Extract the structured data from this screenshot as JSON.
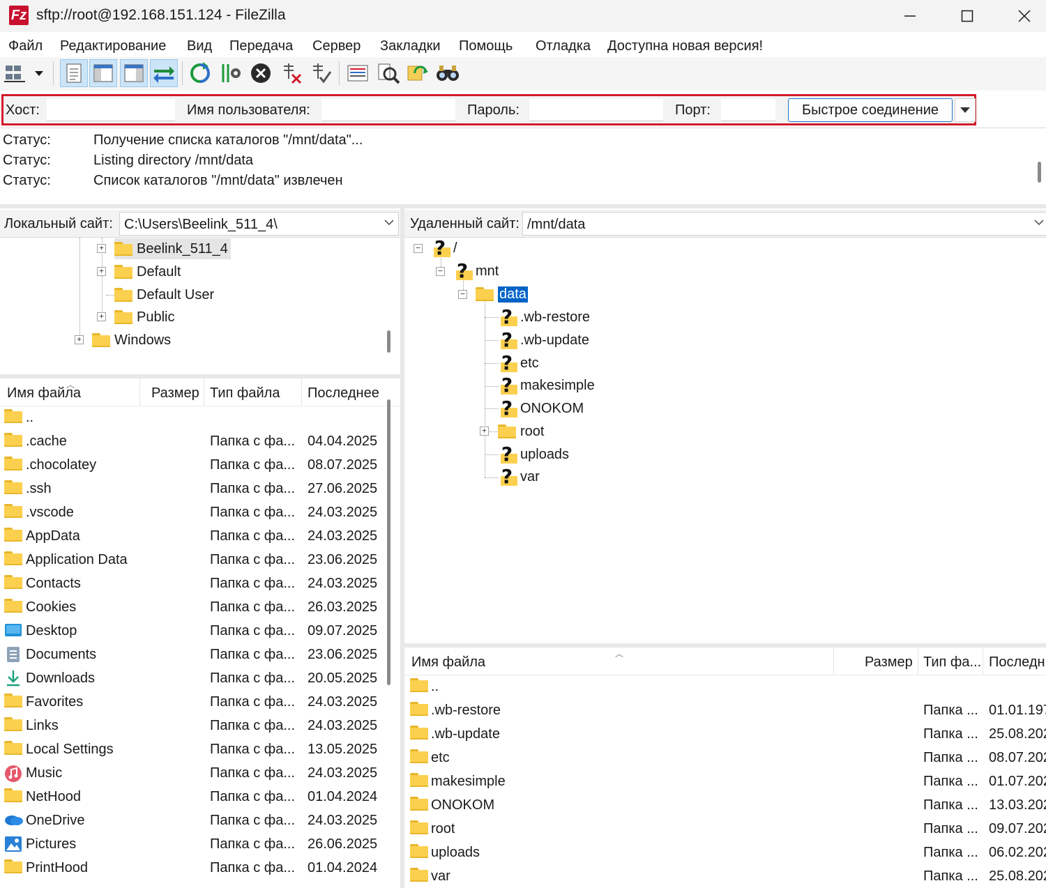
{
  "window": {
    "title": "sftp://root@192.168.151.124 - FileZilla",
    "app_icon_text": "Fz"
  },
  "menu": [
    "Файл",
    "Редактирование",
    "Вид",
    "Передача",
    "Сервер",
    "Закладки",
    "Помощь",
    "Отладка",
    "Доступна новая версия!"
  ],
  "toolbar": {
    "buttons": [
      "site-manager-icon",
      "dropdown-arrow-icon",
      "toggle-log-icon",
      "toggle-local-tree-icon",
      "toggle-remote-tree-icon",
      "toggle-transfer-queue-icon",
      "refresh-icon",
      "process-queue-icon",
      "cancel-icon",
      "disconnect-icon",
      "reconnect-icon",
      "directory-listing-filters-icon",
      "toggle-comparison-icon",
      "synchronized-browsing-icon",
      "search-remote-icon"
    ]
  },
  "quickconnect": {
    "host_label": "Хост:",
    "host_value": "",
    "user_label": "Имя пользователя:",
    "user_value": "",
    "password_label": "Пароль:",
    "password_value": "",
    "port_label": "Порт:",
    "port_value": "",
    "connect_label": "Быстрое соединение",
    "highlight_color": "#d11a2a"
  },
  "log": [
    {
      "label": "Статус:",
      "message": "Получение списка каталогов \"/mnt/data\"..."
    },
    {
      "label": "Статус:",
      "message": "Listing directory /mnt/data"
    },
    {
      "label": "Статус:",
      "message": "Список каталогов \"/mnt/data\" извлечен"
    }
  ],
  "local": {
    "site_label": "Локальный сайт:",
    "path": "C:\\Users\\Beelink_511_4\\",
    "tree": [
      {
        "name": "Beelink_511_4",
        "expander": "+"
      },
      {
        "name": "Default",
        "expander": "+"
      },
      {
        "name": "Default User",
        "expander": ""
      },
      {
        "name": "Public",
        "expander": "+"
      },
      {
        "name": "Windows",
        "expander": "+"
      }
    ],
    "columns": [
      "Имя файла",
      "Размер",
      "Тип файла",
      "Последнее"
    ],
    "files": [
      {
        "name": "..",
        "size": "",
        "type": "",
        "date": "",
        "icon": "folder-icon"
      },
      {
        "name": ".cache",
        "size": "",
        "type": "Папка с фа...",
        "date": "04.04.2025",
        "icon": "folder-icon"
      },
      {
        "name": ".chocolatey",
        "size": "",
        "type": "Папка с фа...",
        "date": "08.07.2025",
        "icon": "folder-icon"
      },
      {
        "name": ".ssh",
        "size": "",
        "type": "Папка с фа...",
        "date": "27.06.2025",
        "icon": "folder-icon"
      },
      {
        "name": ".vscode",
        "size": "",
        "type": "Папка с фа...",
        "date": "24.03.2025",
        "icon": "folder-icon"
      },
      {
        "name": "AppData",
        "size": "",
        "type": "Папка с фа...",
        "date": "24.03.2025",
        "icon": "folder-icon"
      },
      {
        "name": "Application Data",
        "size": "",
        "type": "Папка с фа...",
        "date": "23.06.2025",
        "icon": "folder-icon"
      },
      {
        "name": "Contacts",
        "size": "",
        "type": "Папка с фа...",
        "date": "24.03.2025",
        "icon": "folder-icon"
      },
      {
        "name": "Cookies",
        "size": "",
        "type": "Папка с фа...",
        "date": "26.03.2025",
        "icon": "folder-icon"
      },
      {
        "name": "Desktop",
        "size": "",
        "type": "Папка с фа...",
        "date": "09.07.2025",
        "icon": "desktop-icon"
      },
      {
        "name": "Documents",
        "size": "",
        "type": "Папка с фа...",
        "date": "23.06.2025",
        "icon": "documents-icon"
      },
      {
        "name": "Downloads",
        "size": "",
        "type": "Папка с фа...",
        "date": "20.05.2025",
        "icon": "downloads-icon"
      },
      {
        "name": "Favorites",
        "size": "",
        "type": "Папка с фа...",
        "date": "24.03.2025",
        "icon": "folder-icon"
      },
      {
        "name": "Links",
        "size": "",
        "type": "Папка с фа...",
        "date": "24.03.2025",
        "icon": "folder-icon"
      },
      {
        "name": "Local Settings",
        "size": "",
        "type": "Папка с фа...",
        "date": "13.05.2025",
        "icon": "folder-icon"
      },
      {
        "name": "Music",
        "size": "",
        "type": "Папка с фа...",
        "date": "24.03.2025",
        "icon": "music-icon"
      },
      {
        "name": "NetHood",
        "size": "",
        "type": "Папка с фа...",
        "date": "01.04.2024",
        "icon": "folder-icon"
      },
      {
        "name": "OneDrive",
        "size": "",
        "type": "Папка с фа...",
        "date": "24.03.2025",
        "icon": "onedrive-icon"
      },
      {
        "name": "Pictures",
        "size": "",
        "type": "Папка с фа...",
        "date": "26.06.2025",
        "icon": "pictures-icon"
      },
      {
        "name": "PrintHood",
        "size": "",
        "type": "Папка с фа...",
        "date": "01.04.2024",
        "icon": "folder-icon"
      }
    ]
  },
  "remote": {
    "site_label": "Удаленный сайт:",
    "path": "/mnt/data",
    "tree": [
      {
        "name": "/",
        "expander": "−",
        "icon": "question-icon"
      },
      {
        "name": "mnt",
        "expander": "−",
        "icon": "question-icon"
      },
      {
        "name": "data",
        "expander": "−",
        "icon": "folder-icon",
        "selected": true
      },
      {
        "name": ".wb-restore",
        "expander": "",
        "icon": "question-icon"
      },
      {
        "name": ".wb-update",
        "expander": "",
        "icon": "question-icon"
      },
      {
        "name": "etc",
        "expander": "",
        "icon": "question-icon"
      },
      {
        "name": "makesimple",
        "expander": "",
        "icon": "question-icon"
      },
      {
        "name": "ONOKOM",
        "expander": "",
        "icon": "question-icon"
      },
      {
        "name": "root",
        "expander": "+",
        "icon": "folder-icon"
      },
      {
        "name": "uploads",
        "expander": "",
        "icon": "question-icon"
      },
      {
        "name": "var",
        "expander": "",
        "icon": "question-icon"
      }
    ],
    "columns": [
      "Имя файла",
      "Размер",
      "Тип фа...",
      "Последн"
    ],
    "files": [
      {
        "name": "..",
        "size": "",
        "type": "",
        "date": ""
      },
      {
        "name": ".wb-restore",
        "size": "",
        "type": "Папка ...",
        "date": "01.01.197"
      },
      {
        "name": ".wb-update",
        "size": "",
        "type": "Папка ...",
        "date": "25.08.202"
      },
      {
        "name": "etc",
        "size": "",
        "type": "Папка ...",
        "date": "08.07.202"
      },
      {
        "name": "makesimple",
        "size": "",
        "type": "Папка ...",
        "date": "01.07.202"
      },
      {
        "name": "ONOKOM",
        "size": "",
        "type": "Папка ...",
        "date": "13.03.202"
      },
      {
        "name": "root",
        "size": "",
        "type": "Папка ...",
        "date": "09.07.202"
      },
      {
        "name": "uploads",
        "size": "",
        "type": "Папка ...",
        "date": "06.02.202"
      },
      {
        "name": "var",
        "size": "",
        "type": "Папка ...",
        "date": "25.08.202"
      }
    ]
  }
}
